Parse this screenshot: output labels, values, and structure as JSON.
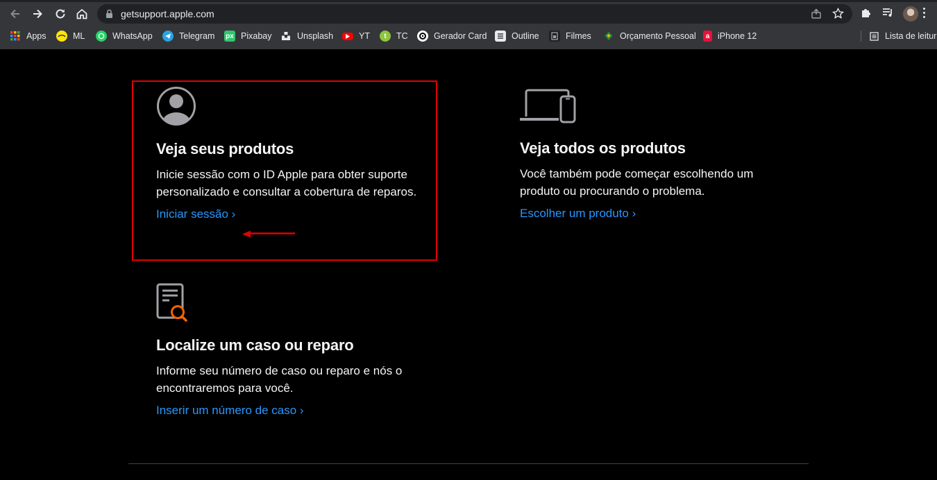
{
  "browser": {
    "url": "getsupport.apple.com",
    "bookmarks": [
      {
        "label": "Apps",
        "icon": "apps-grid-icon"
      },
      {
        "label": "ML",
        "icon": "mercadolivre-icon"
      },
      {
        "label": "WhatsApp",
        "icon": "whatsapp-icon"
      },
      {
        "label": "Telegram",
        "icon": "telegram-icon"
      },
      {
        "label": "Pixabay",
        "icon": "pixabay-icon"
      },
      {
        "label": "Unsplash",
        "icon": "unsplash-icon"
      },
      {
        "label": "YT",
        "icon": "youtube-icon"
      },
      {
        "label": "TC",
        "icon": "tc-icon"
      },
      {
        "label": "Gerador Card",
        "icon": "gerador-card-icon"
      },
      {
        "label": "Outline",
        "icon": "outline-icon"
      },
      {
        "label": "Filmes",
        "icon": "filmes-icon"
      },
      {
        "label": "Orçamento Pessoal",
        "icon": "orcamento-icon"
      },
      {
        "label": "iPhone 12",
        "icon": "iphone-icon"
      }
    ],
    "reading_list": "Lista de leitura"
  },
  "cards": {
    "products": {
      "title": "Veja seus produtos",
      "description": "Inicie sessão com o ID Apple para obter suporte personalizado e consultar a cobertura de reparos.",
      "link": "Iniciar sessão ›"
    },
    "all_products": {
      "title": "Veja todos os produtos",
      "description": "Você também pode começar escolhendo um produto ou procurando o problema.",
      "link": "Escolher um produto ›"
    },
    "case": {
      "title": "Localize um caso ou reparo",
      "description": "Informe seu número de caso ou reparo e nós o encontraremos para você.",
      "link": "Inserir um número de caso ›"
    }
  },
  "colors": {
    "background": "#000000",
    "link": "#2997ff",
    "annotation": "#e30000",
    "text": "#f5f5f7"
  }
}
